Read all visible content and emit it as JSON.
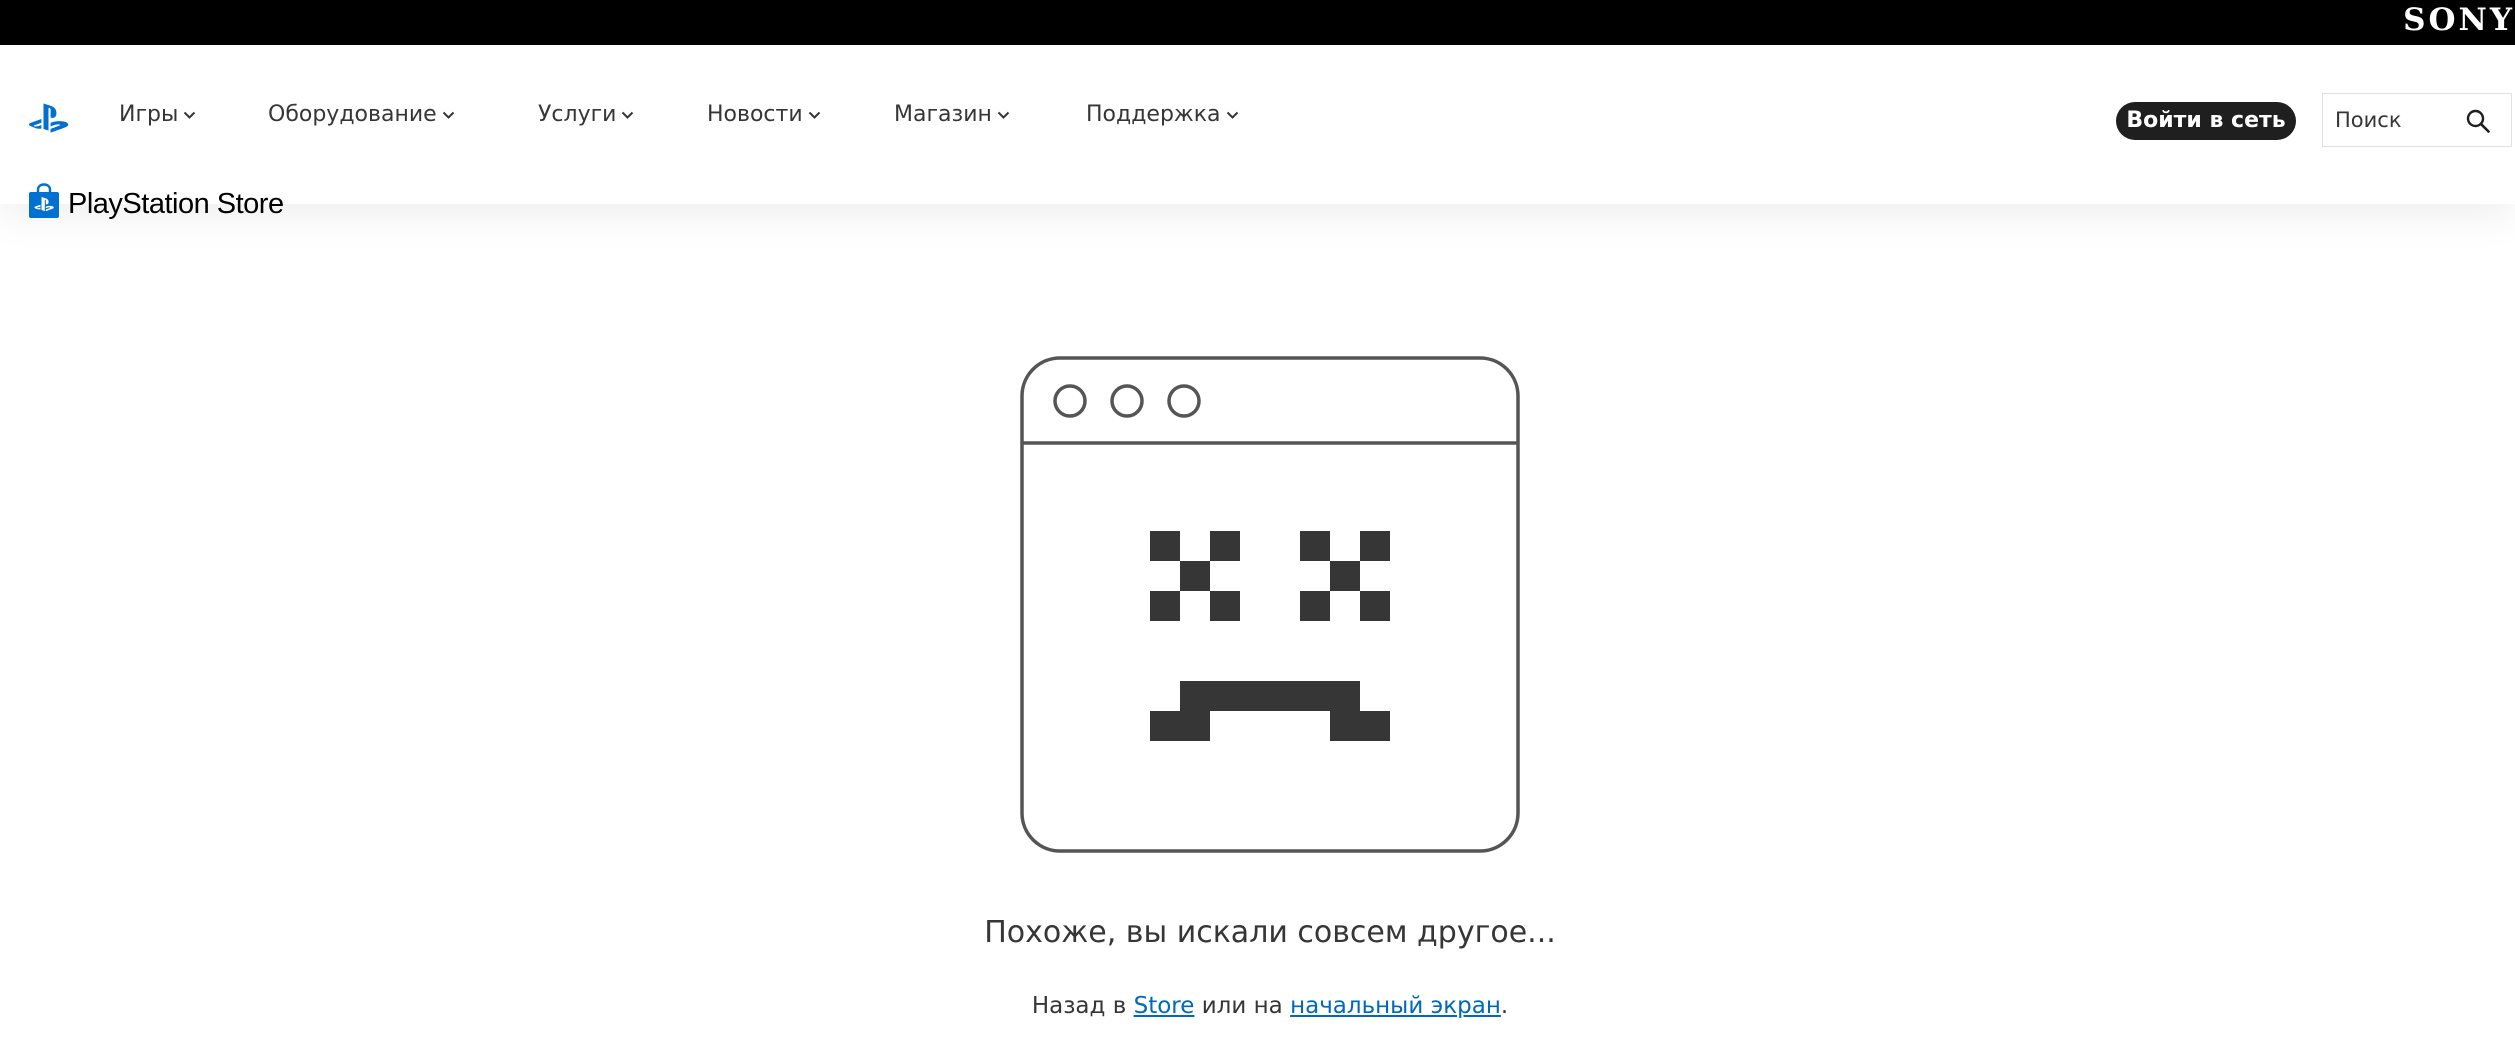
{
  "brand": {
    "sony": "SONY",
    "store_name": "PlayStation Store"
  },
  "nav": [
    {
      "label": "Игры"
    },
    {
      "label": "Оборудование"
    },
    {
      "label": "Услуги"
    },
    {
      "label": "Новости"
    },
    {
      "label": "Магазин"
    },
    {
      "label": "Поддержка"
    }
  ],
  "header": {
    "login_label": "Войти в сеть",
    "search_placeholder": "Поиск"
  },
  "error": {
    "title": "Похоже, вы искали совсем другое...",
    "sub_prefix": "Назад в ",
    "store_link": "Store",
    "sub_middle": " или на ",
    "home_link": "начальный экран",
    "sub_suffix": "."
  },
  "icons": [
    "playstation-logo-icon",
    "chevron-down-icon",
    "search-icon",
    "store-bag-icon",
    "sad-browser-illustration"
  ],
  "colors": {
    "top_bar": "#000000",
    "login_button": "#1f1f1f",
    "link": "#0068bd",
    "text": "#363636",
    "accent": "#0070d1"
  }
}
